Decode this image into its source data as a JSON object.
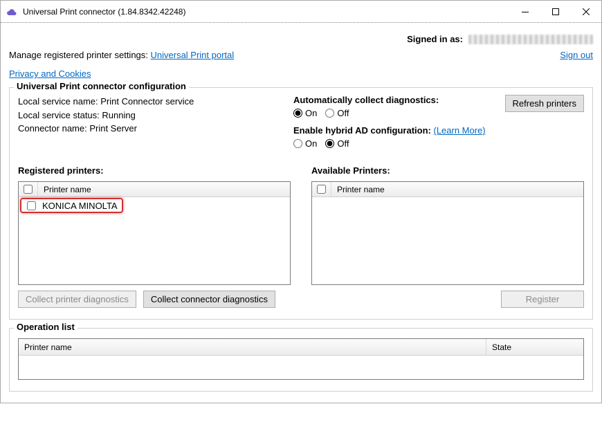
{
  "window": {
    "title": "Universal Print connector (1.84.8342.42248)"
  },
  "signed": {
    "label": "Signed in as:",
    "signout": "Sign out"
  },
  "top": {
    "manage_prefix": "Manage registered printer settings: ",
    "portal_link": "Universal Print portal",
    "privacy_link": "Privacy and Cookies"
  },
  "config": {
    "legend": "Universal Print connector configuration",
    "service_name_label": "Local service name: ",
    "service_name_value": "Print Connector service",
    "service_status_label": "Local service status: ",
    "service_status_value": "Running",
    "connector_name_label": "Connector name: ",
    "connector_name_value": "Print Server",
    "diag_label": "Automatically collect diagnostics:",
    "hybrid_label": "Enable hybrid AD configuration:",
    "learn_more": "(Learn More)",
    "on": "On",
    "off": "Off",
    "refresh_btn": "Refresh printers",
    "diag_value": "On",
    "hybrid_value": "Off"
  },
  "registered": {
    "label": "Registered printers:",
    "header": "Printer name",
    "items": [
      {
        "name": "KONICA MINOLTA"
      }
    ],
    "collect_printer_btn": "Collect printer diagnostics",
    "collect_connector_btn": "Collect connector diagnostics"
  },
  "available": {
    "label": "Available Printers:",
    "header": "Printer name",
    "register_btn": "Register"
  },
  "operation": {
    "legend": "Operation list",
    "col_name": "Printer name",
    "col_state": "State"
  }
}
